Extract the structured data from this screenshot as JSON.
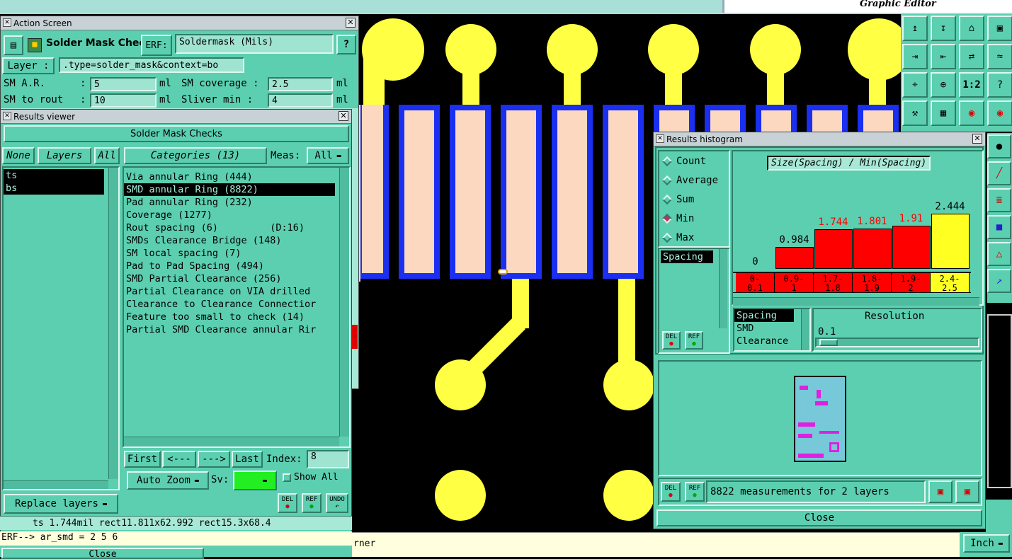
{
  "top": {
    "brand": "Graphic Editor"
  },
  "action": {
    "window_title": "Action Screen",
    "title": "Solder Mask Checks",
    "erf_label": "ERF:",
    "erf_value": "Soldermask (Mils)",
    "help": "?",
    "layer_label": "Layer :",
    "layer_value": ".type=solder_mask&context=bo",
    "sm_ar_label": "SM A.R.",
    "sm_ar_value": "5",
    "sm_cov_label": "SM coverage :",
    "sm_cov_value": "2.5",
    "sm_rout_label": "SM to rout",
    "sm_rout_value": "10",
    "sliver_label": "Sliver  min :",
    "sliver_value": "4",
    "unit": "ml",
    "colon": ":"
  },
  "viewer": {
    "window_title": "Results viewer",
    "header": "Solder Mask Checks",
    "none": "None",
    "layers": "Layers",
    "all": "All",
    "layer_items": [
      "ts",
      "bs"
    ],
    "categories_label": "Categories (13)",
    "meas_label": "Meas:",
    "meas_value": "All",
    "categories": [
      "Via annular Ring (444)",
      "SMD annular Ring (8822)",
      "Pad annular Ring (232)",
      "Coverage (1277)",
      "Rout spacing (6)         (D:16)",
      "SMDs Clearance Bridge (148)",
      "SM local spacing (7)",
      "Pad to Pad Spacing (494)",
      "SMD Partial Clearance (256)",
      "Partial Clearance on VIA drilled",
      "Clearance to Clearance Connectior",
      "Feature too small to check (14)",
      "Partial SMD Clearance annular Rir"
    ],
    "first": "First",
    "prev": "<---",
    "next": "--->",
    "last": "Last",
    "index_label": "Index:",
    "index_value": "8",
    "auto_zoom": "Auto Zoom",
    "sv_label": "Sv:",
    "show_all": "Show All",
    "replace_layers": "Replace layers",
    "del": "DEL",
    "ref": "REF",
    "undo": "UNDO"
  },
  "status": {
    "info": "ts 1.744mil  rect11.811x62.992  rect15.3x68.4",
    "erf_line": "ERF--> ar_smd = 2 5 6",
    "close": "Close",
    "bottom_text": "rner",
    "unit_select": "Inch"
  },
  "histogram": {
    "window_title": "Results histogram",
    "modes": [
      "Count",
      "Average",
      "Sum",
      "Min",
      "Max"
    ],
    "selected_mode": "Min",
    "chart_title": "Size(Spacing) / Min(Spacing)",
    "list_items": [
      "Spacing"
    ],
    "attr_items": [
      "Spacing",
      "SMD",
      "Clearance"
    ],
    "resolution_label": "Resolution",
    "resolution_value": "0.1",
    "summary": "8822 measurements for 2 layers",
    "close": "Close",
    "del": "DEL",
    "ref": "REF"
  },
  "chart_data": {
    "type": "bar",
    "title": "Size(Spacing) / Min(Spacing)",
    "categories": [
      "0-0.1",
      "0.9-1",
      "1.7-1.8",
      "1.8-1.9",
      "1.9-2",
      "2.4-2.5"
    ],
    "category_lines": [
      [
        "0-",
        "0.1"
      ],
      [
        "0.9-",
        "1"
      ],
      [
        "1.7-",
        "1.8"
      ],
      [
        "1.8-",
        "1.9"
      ],
      [
        "1.9-",
        "2"
      ],
      [
        "2.4-",
        "2.5"
      ]
    ],
    "values": [
      0,
      0.984,
      1.744,
      1.801,
      1.91,
      2.444
    ],
    "labels": [
      "0",
      "0.984",
      "1.744",
      "1.801",
      "1.91",
      "2.444"
    ],
    "bar_colors": [
      "#ff0000",
      "#ff0000",
      "#ff0000",
      "#ff0000",
      "#ff0000",
      "#ffff22"
    ],
    "label_colors": [
      "#000000",
      "#000000",
      "#ff0000",
      "#ff0000",
      "#ff0000",
      "#000000"
    ],
    "ylim": [
      0,
      2.444
    ]
  },
  "colors": {
    "panel": "#5ccfb0",
    "pcb_copper": "#ffff44",
    "mask": "#1a2ff0",
    "pad": "#fbd8bf"
  }
}
